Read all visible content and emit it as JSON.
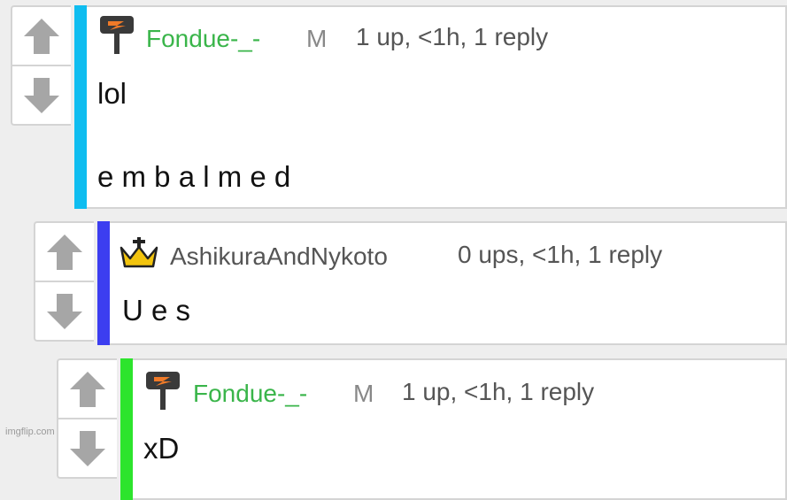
{
  "colors": {
    "background": "#eeeeee",
    "card": "#ffffff",
    "border": "#d4d4d4",
    "arrow": "#a6a6a6",
    "username": "#3ab54a",
    "bar_level1": "#0fbdf0",
    "bar_level2": "#3c3ef0",
    "bar_level3": "#2de42d"
  },
  "comments": [
    {
      "badge_icon": "mod-hammer-icon",
      "username": "Fondue-_-",
      "role_tag": "M",
      "meta": "1 up, <1h, 1 reply",
      "body_line1": "lol",
      "body_line2": "e m b a l m e d"
    },
    {
      "badge_icon": "crown-icon",
      "username": "AshikuraAndNykoto",
      "meta": "0 ups, <1h, 1 reply",
      "body_line1": "U e s"
    },
    {
      "badge_icon": "mod-hammer-icon",
      "username": "Fondue-_-",
      "role_tag": "M",
      "meta": "1 up, <1h, 1 reply",
      "body_line1": "xD"
    }
  ],
  "watermark": "imgflip.com"
}
